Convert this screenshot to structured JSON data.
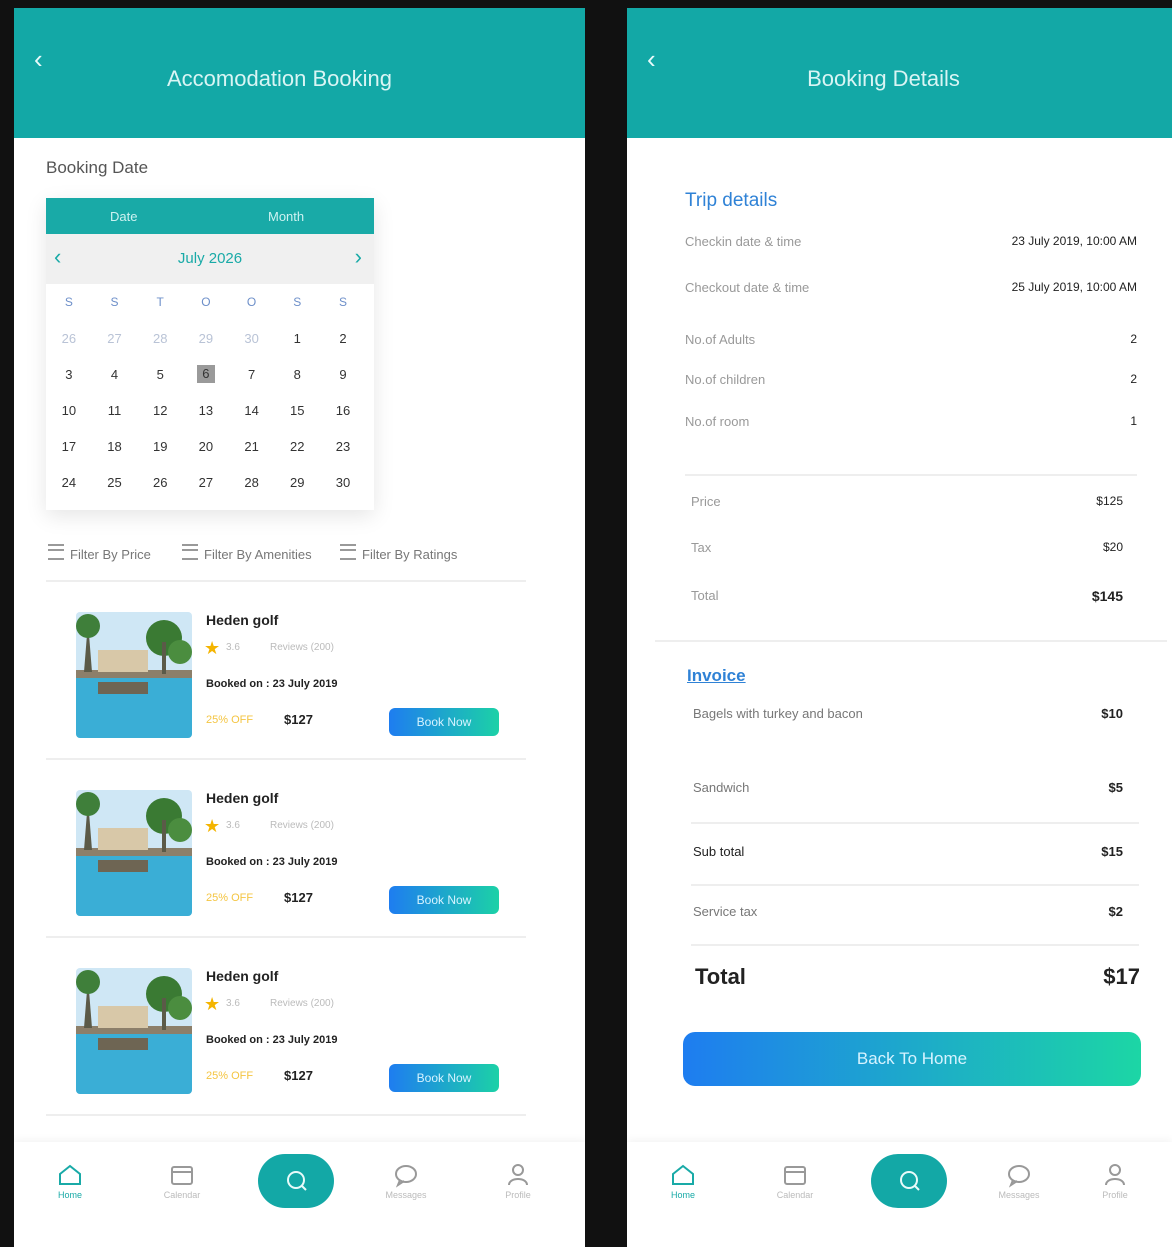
{
  "left": {
    "header": {
      "title": "Accomodation Booking"
    },
    "booking_label": "Booking Date",
    "calendar": {
      "tabs": [
        "Date",
        "Month"
      ],
      "month": "July 2026",
      "weekdays": [
        "S",
        "S",
        "T",
        "O",
        "O",
        "S",
        "S"
      ],
      "weeks": [
        [
          "26",
          "27",
          "28",
          "29",
          "30",
          "1",
          "2"
        ],
        [
          "3",
          "4",
          "5",
          "6",
          "7",
          "8",
          "9"
        ],
        [
          "10",
          "11",
          "12",
          "13",
          "14",
          "15",
          "16"
        ],
        [
          "17",
          "18",
          "19",
          "20",
          "21",
          "22",
          "23"
        ],
        [
          "24",
          "25",
          "26",
          "27",
          "28",
          "29",
          "30"
        ]
      ],
      "selected": "6"
    },
    "filters": [
      "Filter By Price",
      "Filter By Amenities",
      "Filter By Ratings"
    ],
    "hotels": [
      {
        "name": "Heden golf",
        "rating": "3.6",
        "reviews": "Reviews (200)",
        "booked": "Booked on : 23 July 2019",
        "discount": "25% OFF",
        "price": "$127",
        "cta": "Book Now"
      },
      {
        "name": "Heden golf",
        "rating": "3.6",
        "reviews": "Reviews (200)",
        "booked": "Booked on : 23 July 2019",
        "discount": "25% OFF",
        "price": "$127",
        "cta": "Book Now"
      },
      {
        "name": "Heden golf",
        "rating": "3.6",
        "reviews": "Reviews (200)",
        "booked": "Booked on : 23 July 2019",
        "discount": "25% OFF",
        "price": "$127",
        "cta": "Book Now"
      }
    ],
    "nav": [
      "Home",
      "Calendar",
      "",
      "Messages",
      "Profile"
    ]
  },
  "right": {
    "header": {
      "title": "Booking Details"
    },
    "trip_title": "Trip details",
    "trip": [
      {
        "k": "Checkin date & time",
        "v": "23 July 2019, 10:00 AM"
      },
      {
        "k": "Checkout date & time",
        "v": "25 July 2019, 10:00 AM"
      },
      {
        "k": "No.of Adults",
        "v": "2"
      },
      {
        "k": "No.of children",
        "v": "2"
      },
      {
        "k": "No.of room",
        "v": "1"
      }
    ],
    "pricing": [
      {
        "k": "Price",
        "v": "$125"
      },
      {
        "k": "Tax",
        "v": "$20"
      },
      {
        "k": "Total",
        "v": "$145"
      }
    ],
    "invoice_title": "Invoice",
    "invoice": [
      {
        "k": "Bagels with turkey and bacon",
        "v": "$10"
      },
      {
        "k": "Sandwich",
        "v": "$5"
      },
      {
        "k": "Sub total",
        "v": "$15"
      },
      {
        "k": "Service tax",
        "v": "$2"
      }
    ],
    "total_label": "Total",
    "total_value": "$17",
    "cta": "Back To Home",
    "nav": [
      "Home",
      "Calendar",
      "",
      "Messages",
      "Profile"
    ]
  },
  "colors": {
    "accent": "#13a8a6",
    "link": "#2f82d6",
    "star": "#f4b400",
    "gradient_start": "#1e7df0",
    "gradient_end": "#1cd1a7"
  }
}
